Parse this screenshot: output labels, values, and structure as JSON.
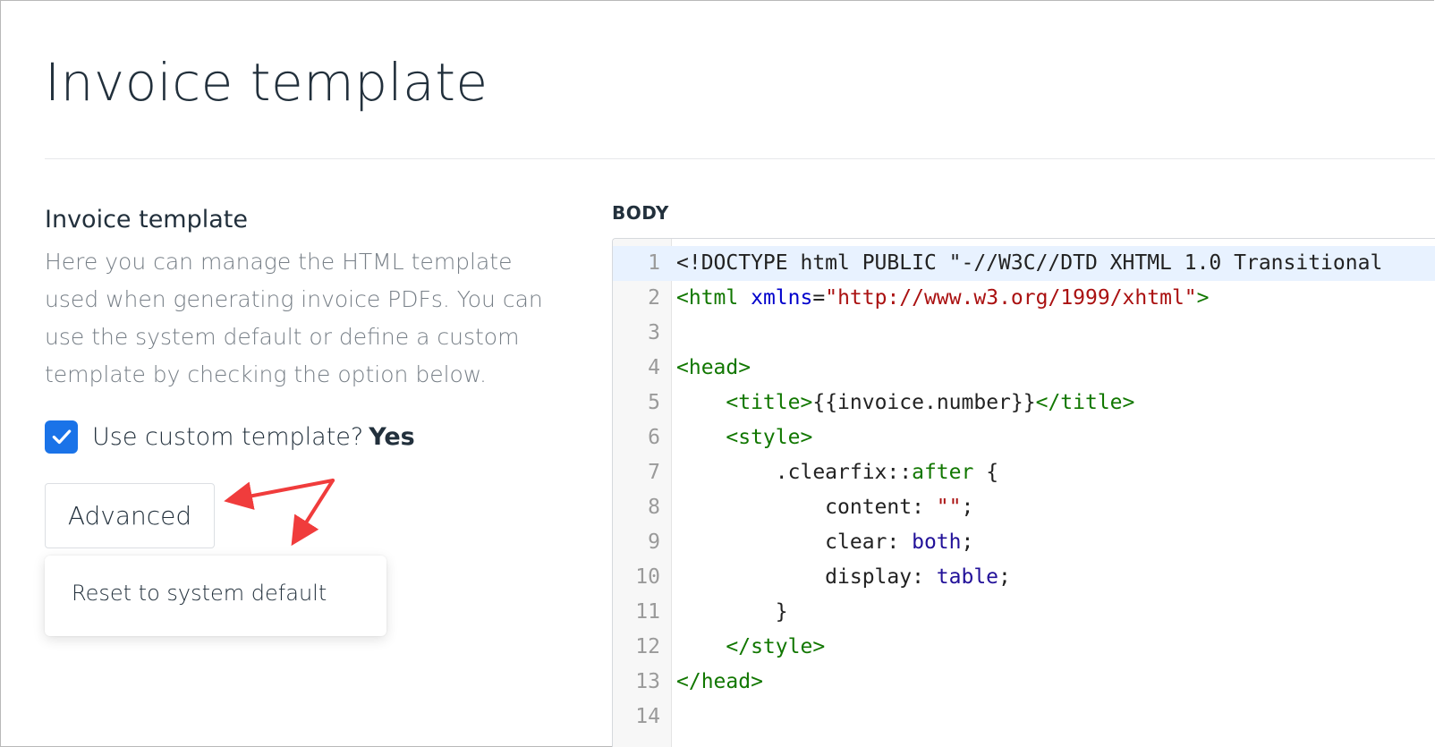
{
  "page": {
    "title": "Invoice template"
  },
  "settings": {
    "section_title": "Invoice template",
    "description": "Here you can manage the HTML template used when generating invoice PDFs. You can use the system default or define a custom template by checking the option below.",
    "custom_template_label": "Use custom template?",
    "custom_template_value": "Yes",
    "custom_template_checked": true,
    "advanced_button": "Advanced",
    "dropdown_items": [
      "Reset to system default"
    ]
  },
  "editor": {
    "label": "BODY",
    "lines": [
      "<!DOCTYPE html PUBLIC \"-//W3C//DTD XHTML 1.0 Transitional",
      "<html xmlns=\"http://www.w3.org/1999/xhtml\">",
      "",
      "<head>",
      "    <title>{{invoice.number}}</title>",
      "    <style>",
      "        .clearfix::after {",
      "            content: \"\";",
      "            clear: both;",
      "            display: table;",
      "        }",
      "    </style>",
      "</head>",
      ""
    ],
    "active_line": 1
  },
  "colors": {
    "accent": "#1a73e8",
    "annotation_arrow": "#f03c3c",
    "active_line_bg": "#e8f2ff"
  },
  "icons": {
    "checkbox": "checkmark-icon"
  }
}
